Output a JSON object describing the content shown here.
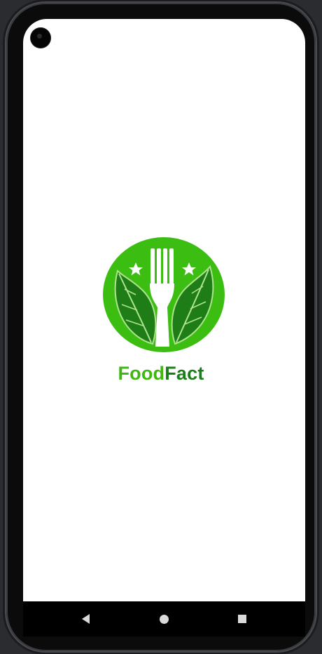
{
  "app": {
    "brand_part1": "Food",
    "brand_part2": "Fact"
  },
  "colors": {
    "background": "#ffffff",
    "brand_light_green": "#3cb80e",
    "brand_dark_green": "#1a7f18"
  },
  "icons": {
    "logo": "fork-leaf-logo-icon",
    "camera": "camera-icon",
    "back": "back-triangle-icon",
    "home": "home-circle-icon",
    "recents": "recents-square-icon"
  }
}
